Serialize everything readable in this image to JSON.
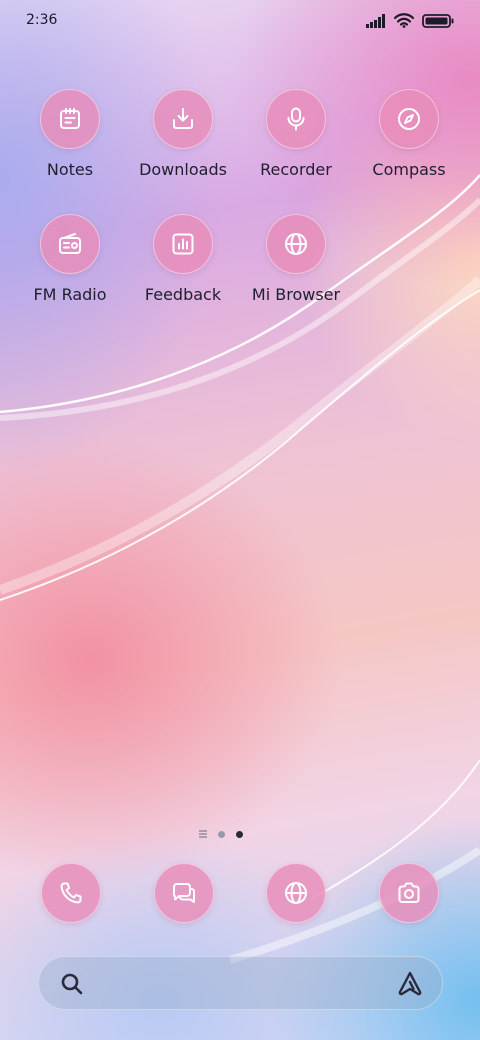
{
  "status_bar": {
    "time": "2:36",
    "icons": [
      "signal-icon",
      "wifi-icon",
      "battery-icon"
    ]
  },
  "apps": [
    {
      "label": "Notes",
      "icon": "notes-icon"
    },
    {
      "label": "Downloads",
      "icon": "download-icon"
    },
    {
      "label": "Recorder",
      "icon": "microphone-icon"
    },
    {
      "label": "Compass",
      "icon": "compass-icon"
    },
    {
      "label": "FM Radio",
      "icon": "radio-icon"
    },
    {
      "label": "Feedback",
      "icon": "chart-icon"
    },
    {
      "label": "Mi Browser",
      "icon": "globe-icon"
    }
  ],
  "page_indicator": {
    "pages": 3,
    "active_index": 2
  },
  "dock": [
    {
      "icon": "phone-icon"
    },
    {
      "icon": "messages-icon"
    },
    {
      "icon": "browser-icon"
    },
    {
      "icon": "camera-icon"
    }
  ],
  "search_bar": {
    "left_icon": "search-icon",
    "right_icon": "assistant-icon"
  },
  "colors": {
    "icon_bg": "#E88CBA",
    "icon_glyph": "#FFFFFF",
    "label_text": "#1F1F2E"
  }
}
